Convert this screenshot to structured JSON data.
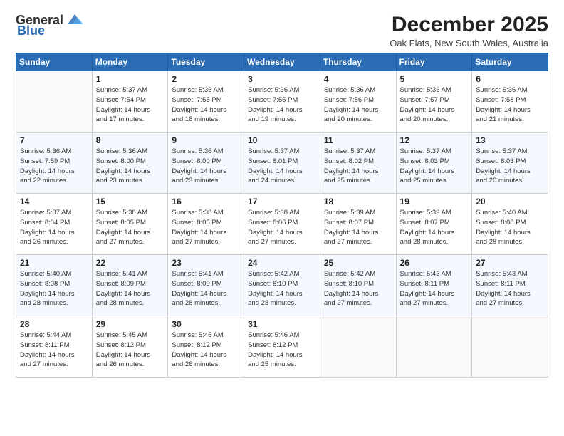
{
  "logo": {
    "general": "General",
    "blue": "Blue"
  },
  "title": "December 2025",
  "location": "Oak Flats, New South Wales, Australia",
  "weekdays": [
    "Sunday",
    "Monday",
    "Tuesday",
    "Wednesday",
    "Thursday",
    "Friday",
    "Saturday"
  ],
  "weeks": [
    [
      {
        "day": "",
        "sunrise": "",
        "sunset": "",
        "daylight": ""
      },
      {
        "day": "1",
        "sunrise": "Sunrise: 5:37 AM",
        "sunset": "Sunset: 7:54 PM",
        "daylight": "Daylight: 14 hours and 17 minutes."
      },
      {
        "day": "2",
        "sunrise": "Sunrise: 5:36 AM",
        "sunset": "Sunset: 7:55 PM",
        "daylight": "Daylight: 14 hours and 18 minutes."
      },
      {
        "day": "3",
        "sunrise": "Sunrise: 5:36 AM",
        "sunset": "Sunset: 7:55 PM",
        "daylight": "Daylight: 14 hours and 19 minutes."
      },
      {
        "day": "4",
        "sunrise": "Sunrise: 5:36 AM",
        "sunset": "Sunset: 7:56 PM",
        "daylight": "Daylight: 14 hours and 20 minutes."
      },
      {
        "day": "5",
        "sunrise": "Sunrise: 5:36 AM",
        "sunset": "Sunset: 7:57 PM",
        "daylight": "Daylight: 14 hours and 20 minutes."
      },
      {
        "day": "6",
        "sunrise": "Sunrise: 5:36 AM",
        "sunset": "Sunset: 7:58 PM",
        "daylight": "Daylight: 14 hours and 21 minutes."
      }
    ],
    [
      {
        "day": "7",
        "sunrise": "Sunrise: 5:36 AM",
        "sunset": "Sunset: 7:59 PM",
        "daylight": "Daylight: 14 hours and 22 minutes."
      },
      {
        "day": "8",
        "sunrise": "Sunrise: 5:36 AM",
        "sunset": "Sunset: 8:00 PM",
        "daylight": "Daylight: 14 hours and 23 minutes."
      },
      {
        "day": "9",
        "sunrise": "Sunrise: 5:36 AM",
        "sunset": "Sunset: 8:00 PM",
        "daylight": "Daylight: 14 hours and 23 minutes."
      },
      {
        "day": "10",
        "sunrise": "Sunrise: 5:37 AM",
        "sunset": "Sunset: 8:01 PM",
        "daylight": "Daylight: 14 hours and 24 minutes."
      },
      {
        "day": "11",
        "sunrise": "Sunrise: 5:37 AM",
        "sunset": "Sunset: 8:02 PM",
        "daylight": "Daylight: 14 hours and 25 minutes."
      },
      {
        "day": "12",
        "sunrise": "Sunrise: 5:37 AM",
        "sunset": "Sunset: 8:03 PM",
        "daylight": "Daylight: 14 hours and 25 minutes."
      },
      {
        "day": "13",
        "sunrise": "Sunrise: 5:37 AM",
        "sunset": "Sunset: 8:03 PM",
        "daylight": "Daylight: 14 hours and 26 minutes."
      }
    ],
    [
      {
        "day": "14",
        "sunrise": "Sunrise: 5:37 AM",
        "sunset": "Sunset: 8:04 PM",
        "daylight": "Daylight: 14 hours and 26 minutes."
      },
      {
        "day": "15",
        "sunrise": "Sunrise: 5:38 AM",
        "sunset": "Sunset: 8:05 PM",
        "daylight": "Daylight: 14 hours and 27 minutes."
      },
      {
        "day": "16",
        "sunrise": "Sunrise: 5:38 AM",
        "sunset": "Sunset: 8:05 PM",
        "daylight": "Daylight: 14 hours and 27 minutes."
      },
      {
        "day": "17",
        "sunrise": "Sunrise: 5:38 AM",
        "sunset": "Sunset: 8:06 PM",
        "daylight": "Daylight: 14 hours and 27 minutes."
      },
      {
        "day": "18",
        "sunrise": "Sunrise: 5:39 AM",
        "sunset": "Sunset: 8:07 PM",
        "daylight": "Daylight: 14 hours and 27 minutes."
      },
      {
        "day": "19",
        "sunrise": "Sunrise: 5:39 AM",
        "sunset": "Sunset: 8:07 PM",
        "daylight": "Daylight: 14 hours and 28 minutes."
      },
      {
        "day": "20",
        "sunrise": "Sunrise: 5:40 AM",
        "sunset": "Sunset: 8:08 PM",
        "daylight": "Daylight: 14 hours and 28 minutes."
      }
    ],
    [
      {
        "day": "21",
        "sunrise": "Sunrise: 5:40 AM",
        "sunset": "Sunset: 8:08 PM",
        "daylight": "Daylight: 14 hours and 28 minutes."
      },
      {
        "day": "22",
        "sunrise": "Sunrise: 5:41 AM",
        "sunset": "Sunset: 8:09 PM",
        "daylight": "Daylight: 14 hours and 28 minutes."
      },
      {
        "day": "23",
        "sunrise": "Sunrise: 5:41 AM",
        "sunset": "Sunset: 8:09 PM",
        "daylight": "Daylight: 14 hours and 28 minutes."
      },
      {
        "day": "24",
        "sunrise": "Sunrise: 5:42 AM",
        "sunset": "Sunset: 8:10 PM",
        "daylight": "Daylight: 14 hours and 28 minutes."
      },
      {
        "day": "25",
        "sunrise": "Sunrise: 5:42 AM",
        "sunset": "Sunset: 8:10 PM",
        "daylight": "Daylight: 14 hours and 27 minutes."
      },
      {
        "day": "26",
        "sunrise": "Sunrise: 5:43 AM",
        "sunset": "Sunset: 8:11 PM",
        "daylight": "Daylight: 14 hours and 27 minutes."
      },
      {
        "day": "27",
        "sunrise": "Sunrise: 5:43 AM",
        "sunset": "Sunset: 8:11 PM",
        "daylight": "Daylight: 14 hours and 27 minutes."
      }
    ],
    [
      {
        "day": "28",
        "sunrise": "Sunrise: 5:44 AM",
        "sunset": "Sunset: 8:11 PM",
        "daylight": "Daylight: 14 hours and 27 minutes."
      },
      {
        "day": "29",
        "sunrise": "Sunrise: 5:45 AM",
        "sunset": "Sunset: 8:12 PM",
        "daylight": "Daylight: 14 hours and 26 minutes."
      },
      {
        "day": "30",
        "sunrise": "Sunrise: 5:45 AM",
        "sunset": "Sunset: 8:12 PM",
        "daylight": "Daylight: 14 hours and 26 minutes."
      },
      {
        "day": "31",
        "sunrise": "Sunrise: 5:46 AM",
        "sunset": "Sunset: 8:12 PM",
        "daylight": "Daylight: 14 hours and 25 minutes."
      },
      {
        "day": "",
        "sunrise": "",
        "sunset": "",
        "daylight": ""
      },
      {
        "day": "",
        "sunrise": "",
        "sunset": "",
        "daylight": ""
      },
      {
        "day": "",
        "sunrise": "",
        "sunset": "",
        "daylight": ""
      }
    ]
  ]
}
